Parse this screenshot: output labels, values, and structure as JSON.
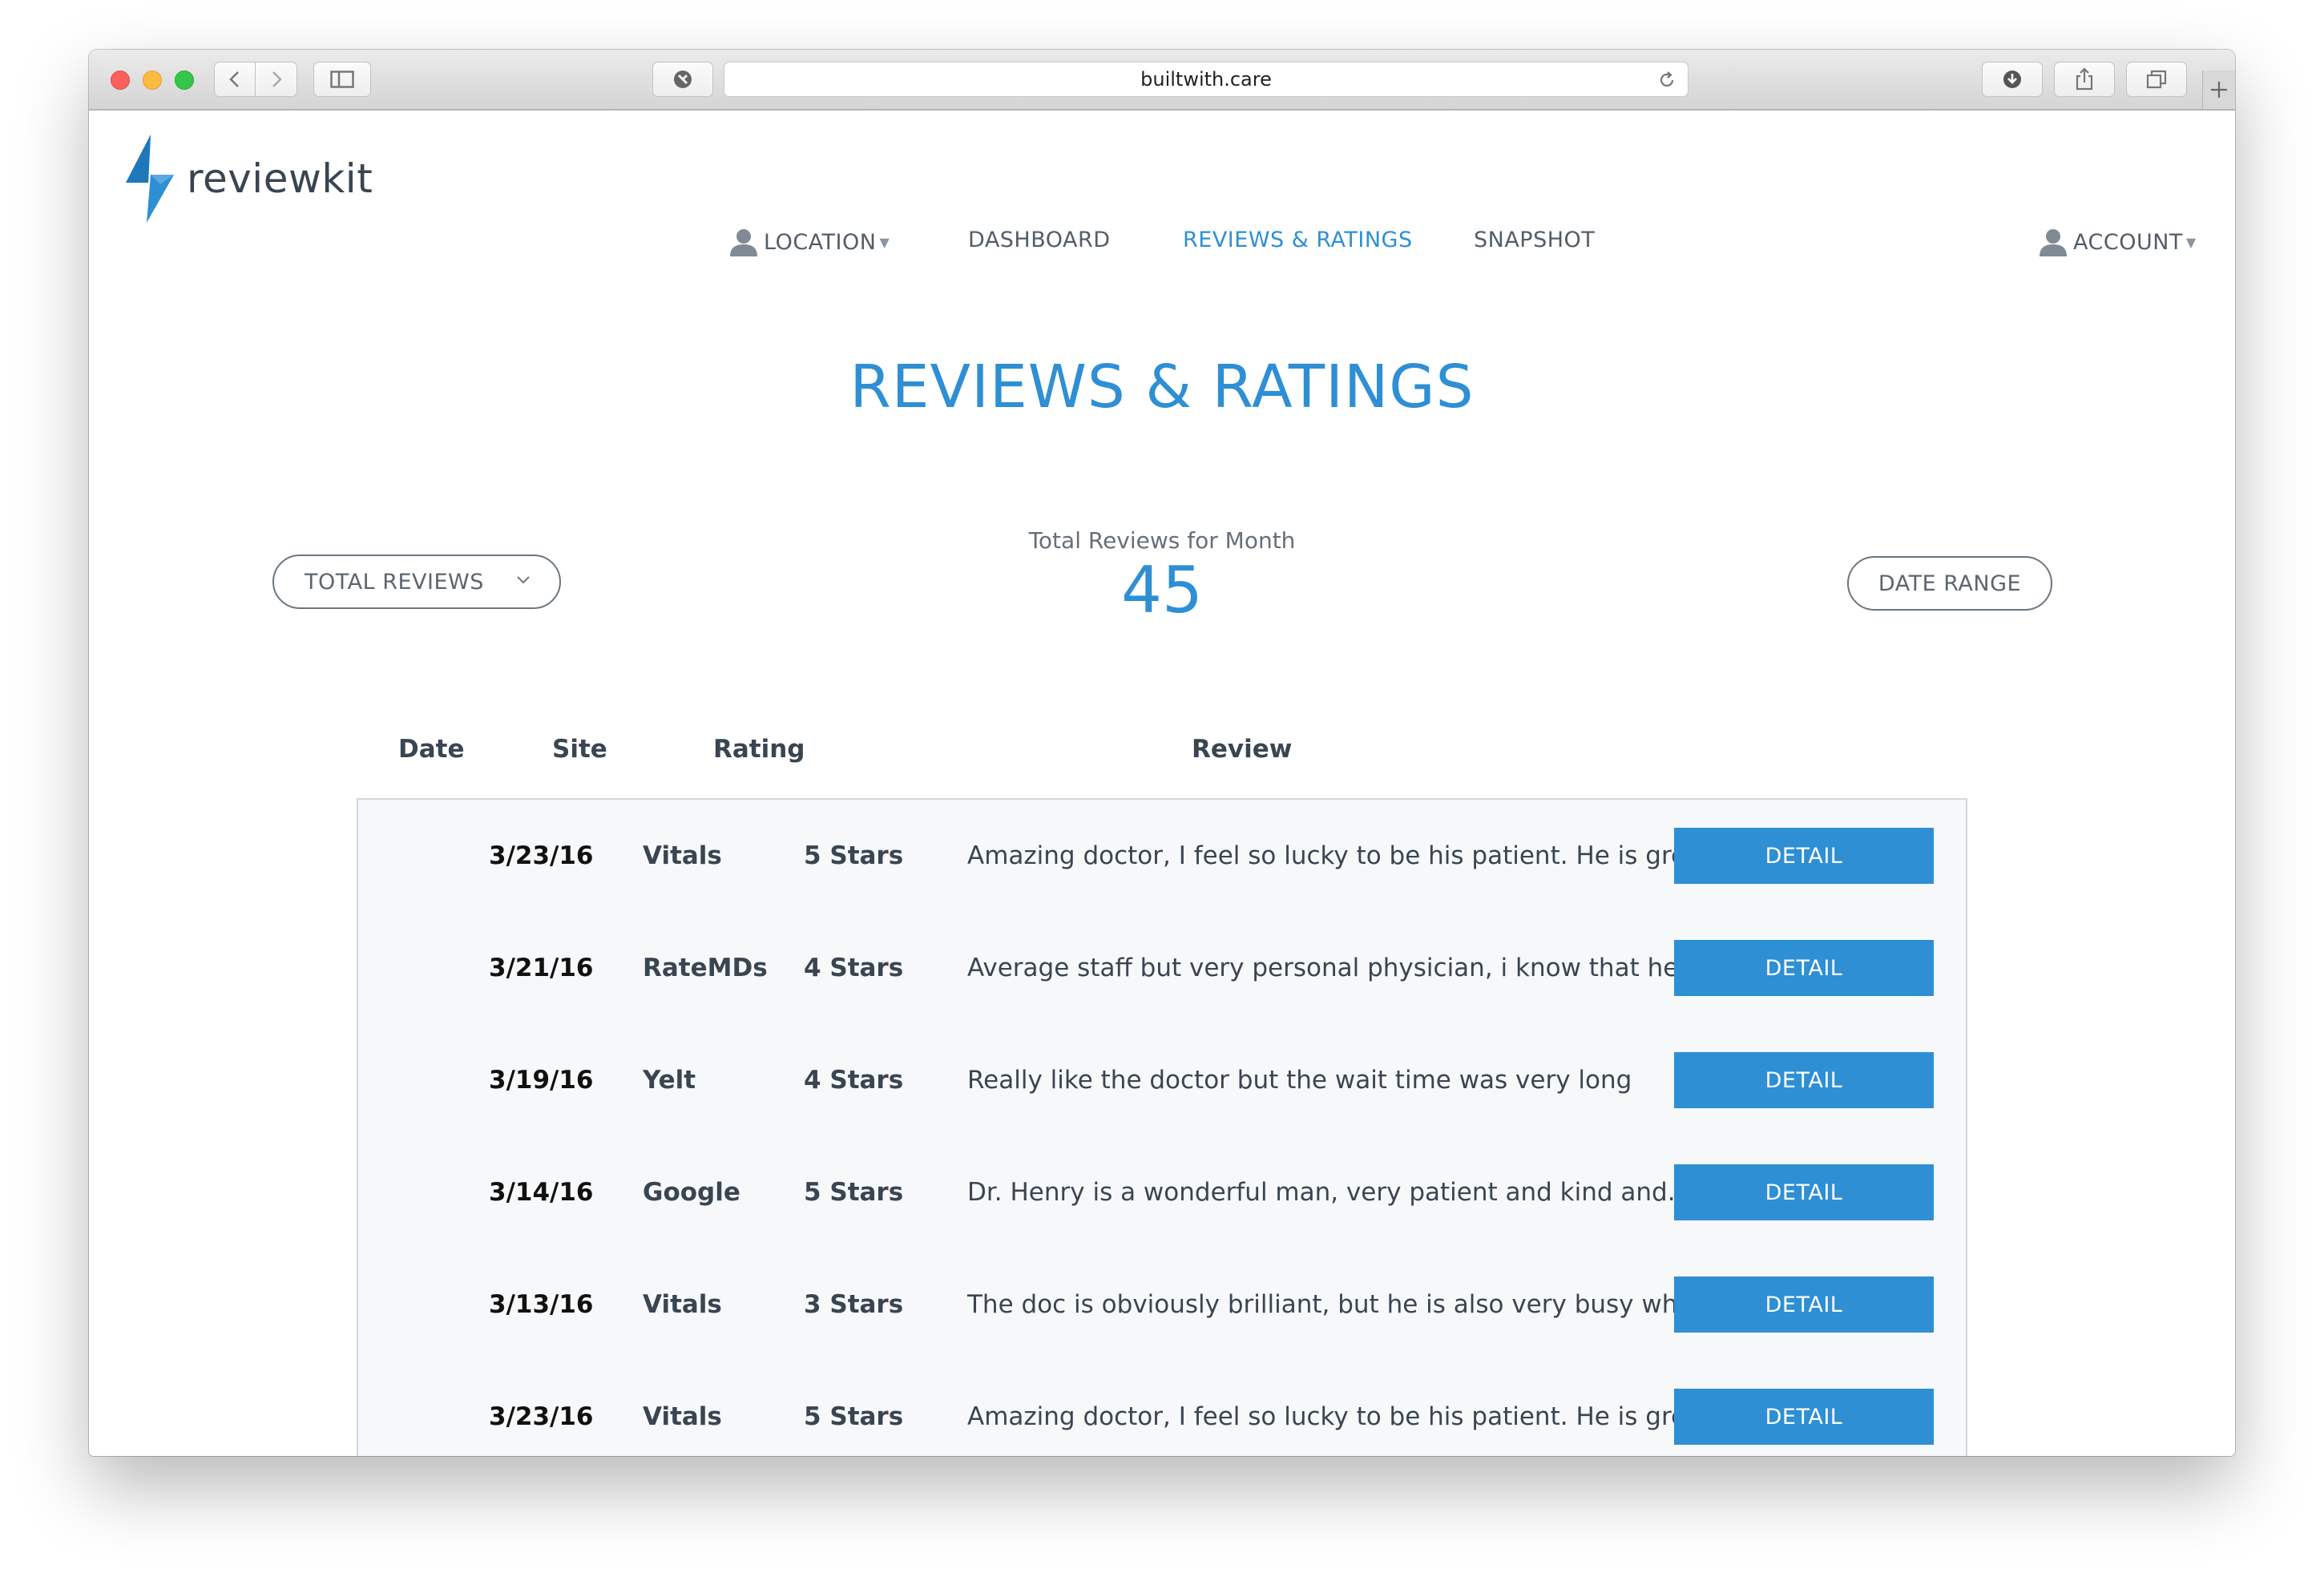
{
  "browser": {
    "url": "builtwith.care"
  },
  "brand": {
    "name": "reviewkit",
    "accent_color": "#2e8fd4"
  },
  "nav": {
    "location": "LOCATION",
    "dashboard": "DASHBOARD",
    "reviews": "REVIEWS & RATINGS",
    "snapshot": "SNAPSHOT",
    "account": "ACCOUNT"
  },
  "page": {
    "title": "REVIEWS & RATINGS",
    "total_label": "Total Reviews for Month",
    "total_value": "45",
    "filter_label": "TOTAL REVIEWS",
    "date_range_label": "DATE RANGE"
  },
  "table": {
    "headers": {
      "date": "Date",
      "site": "Site",
      "rating": "Rating",
      "review": "Review"
    },
    "detail_label": "DETAIL",
    "rows": [
      {
        "date": "3/23/16",
        "site": "Vitals",
        "rating": "5 Stars",
        "review": "Amazing doctor, I feel so lucky to be his patient. He is grea..."
      },
      {
        "date": "3/21/16",
        "site": "RateMDs",
        "rating": "4 Stars",
        "review": "Average staff but very personal physician, i know that he is..."
      },
      {
        "date": "3/19/16",
        "site": "Yelt",
        "rating": "4 Stars",
        "review": "Really like the doctor but the wait time was very long"
      },
      {
        "date": "3/14/16",
        "site": "Google",
        "rating": "5 Stars",
        "review": "Dr. Henry is a wonderful man, very patient and kind and..."
      },
      {
        "date": "3/13/16",
        "site": "Vitals",
        "rating": "3 Stars",
        "review": "The doc is obviously brilliant, but he is also very busy whic..."
      },
      {
        "date": "3/23/16",
        "site": "Vitals",
        "rating": "5 Stars",
        "review": "Amazing doctor, I feel so lucky to be his patient. He is grea..."
      }
    ]
  }
}
